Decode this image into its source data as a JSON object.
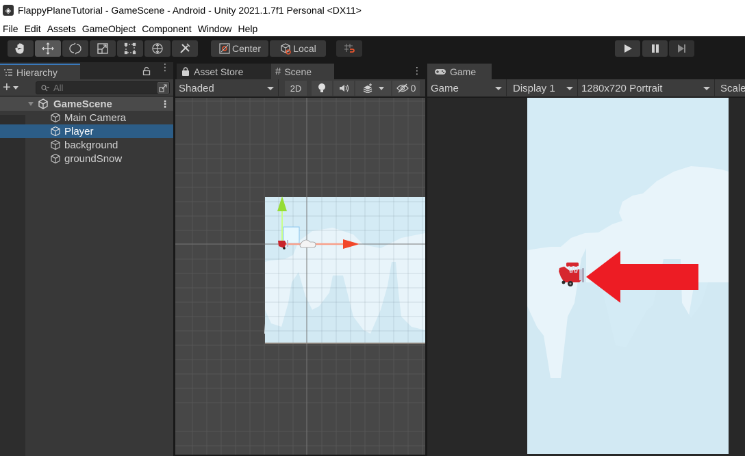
{
  "window": {
    "title": "FlappyPlaneTutorial - GameScene - Android - Unity 2021.1.7f1 Personal <DX11>"
  },
  "menu": {
    "items": [
      "File",
      "Edit",
      "Assets",
      "GameObject",
      "Component",
      "Window",
      "Help"
    ]
  },
  "toolbar": {
    "tools": [
      {
        "name": "hand-tool",
        "active": false
      },
      {
        "name": "move-tool",
        "active": true
      },
      {
        "name": "rotate-tool",
        "active": false
      },
      {
        "name": "scale-tool",
        "active": false
      },
      {
        "name": "rect-tool",
        "active": false
      },
      {
        "name": "transform-tool",
        "active": false
      },
      {
        "name": "custom-editor-tool",
        "active": false
      }
    ],
    "pivot_mode_label": "Center",
    "pivot_rotation_label": "Local",
    "playback": {
      "play": "play",
      "pause": "pause",
      "step": "step"
    }
  },
  "hierarchy": {
    "tab_label": "Hierarchy",
    "search_placeholder": "All",
    "scene_name": "GameScene",
    "items": [
      {
        "label": "Main Camera",
        "selected": false
      },
      {
        "label": "Player",
        "selected": true
      },
      {
        "label": "background",
        "selected": false
      },
      {
        "label": "groundSnow",
        "selected": false
      }
    ]
  },
  "scene_panel": {
    "tabs": [
      {
        "label": "Asset Store",
        "active": false
      },
      {
        "label": "Scene",
        "active": true
      }
    ],
    "shading_mode": "Shaded",
    "mode_2d_label": "2D",
    "hidden_count": "0"
  },
  "game_panel": {
    "tab_label": "Game",
    "view_mode": "Game",
    "display": "Display 1",
    "resolution": "1280x720 Portrait",
    "scale_label": "Scale"
  },
  "colors": {
    "accent_blue": "#3a79bb",
    "selection": "#2c5d87",
    "sky": "#d4ebf5",
    "cloud": "#e8f4fa",
    "annotation_arrow": "#ed1c24",
    "gizmo_x": "#f0553a",
    "gizmo_y": "#a8e43a"
  }
}
